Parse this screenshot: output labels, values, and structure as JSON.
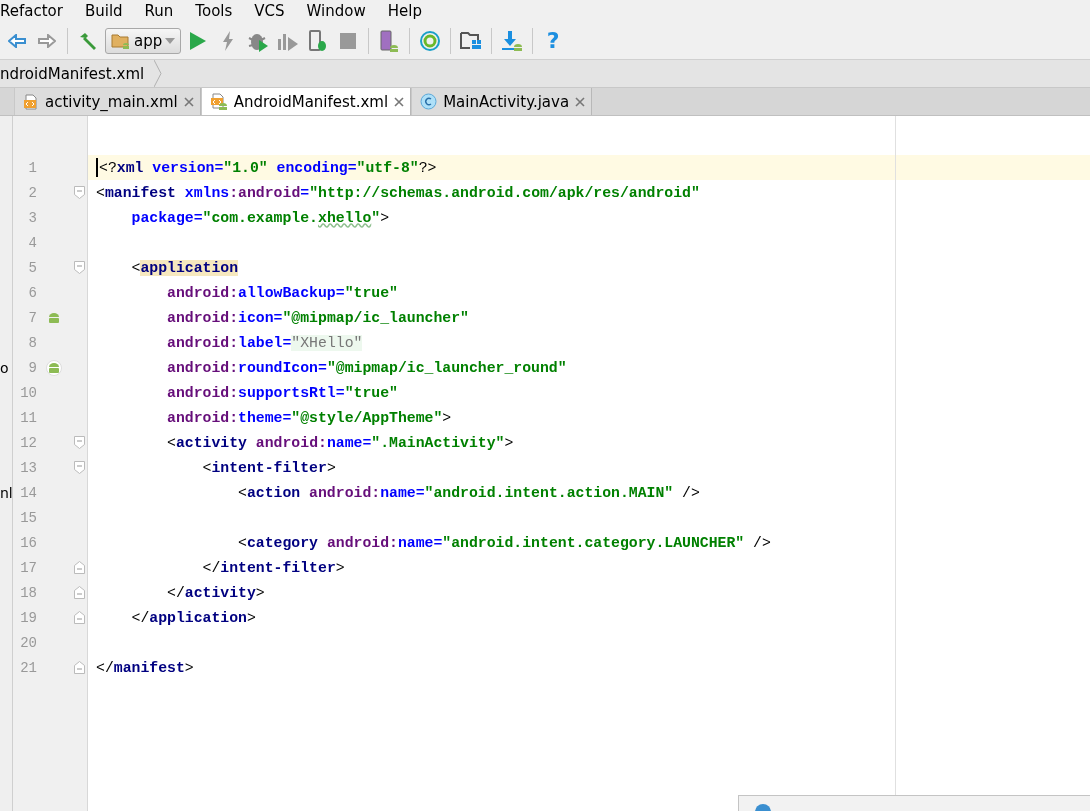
{
  "menu": [
    "Refactor",
    "Build",
    "Run",
    "Tools",
    "VCS",
    "Window",
    "Help"
  ],
  "toolbar": {
    "config": "app",
    "help": "?"
  },
  "breadcrumb": "ndroidManifest.xml",
  "tabs": [
    {
      "label": "activity_main.xml",
      "kind": "xml",
      "selected": false
    },
    {
      "label": "AndroidManifest.xml",
      "kind": "manifest",
      "selected": true
    },
    {
      "label": "MainActivity.java",
      "kind": "class",
      "selected": false
    }
  ],
  "lines": [
    {
      "number": "1",
      "current": true,
      "tokens": [
        {
          "kind": "punct",
          "text": "<?"
        },
        {
          "kind": "tag",
          "text": "xml"
        },
        {
          "kind": "attr",
          "text": " version="
        },
        {
          "kind": "value",
          "text": "\"1.0\""
        },
        {
          "kind": "attr",
          "text": " encoding="
        },
        {
          "kind": "value",
          "text": "\"utf-8\""
        },
        {
          "kind": "punct",
          "text": "?>"
        }
      ]
    },
    {
      "number": "2",
      "current": false,
      "fold_start": true,
      "tokens": [
        {
          "kind": "punct",
          "text": "<"
        },
        {
          "kind": "tag",
          "text": "manifest"
        },
        {
          "kind": "attr",
          "text": " xmlns"
        },
        {
          "kind": "ns",
          "text": ":android"
        },
        {
          "kind": "attr",
          "text": "="
        },
        {
          "kind": "value",
          "text": "\"http://schemas.android.com/apk/res/android\""
        }
      ]
    },
    {
      "number": "3",
      "current": false,
      "tokens": [
        {
          "kind": "attr",
          "text": "    package="
        },
        {
          "kind": "value",
          "text": "\"com.example."
        },
        {
          "kind": "value",
          "text": "xhello",
          "typo": true
        },
        {
          "kind": "value",
          "text": "\""
        },
        {
          "kind": "punct",
          "text": ">"
        }
      ]
    },
    {
      "number": "4",
      "current": false
    },
    {
      "number": "5",
      "current": false,
      "fold_start": true,
      "tokens": [
        {
          "kind": "punct",
          "text": "    <"
        },
        {
          "kind": "tag",
          "text": "application",
          "matched": true
        }
      ]
    },
    {
      "number": "6",
      "current": false,
      "tokens": [
        {
          "kind": "ns",
          "text": "        android:"
        },
        {
          "kind": "attr",
          "text": "allowBackup="
        },
        {
          "kind": "value",
          "text": "\"true\""
        }
      ]
    },
    {
      "number": "7",
      "current": false,
      "android_icon": true,
      "tokens": [
        {
          "kind": "ns",
          "text": "        android:"
        },
        {
          "kind": "attr",
          "text": "icon="
        },
        {
          "kind": "value",
          "text": "\"@mipmap/ic_launcher\""
        }
      ]
    },
    {
      "number": "8",
      "current": false,
      "tokens": [
        {
          "kind": "ns",
          "text": "        android:"
        },
        {
          "kind": "attr",
          "text": "label="
        },
        {
          "kind": "value",
          "text": "\"XHello\"",
          "hint": true
        }
      ]
    },
    {
      "number": "9",
      "current": false,
      "android_round_icon": true,
      "side_text": "o",
      "tokens": [
        {
          "kind": "ns",
          "text": "        android:"
        },
        {
          "kind": "attr",
          "text": "roundIcon="
        },
        {
          "kind": "value",
          "text": "\"@mipmap/ic_launcher_round\""
        }
      ]
    },
    {
      "number": "10",
      "current": false,
      "tokens": [
        {
          "kind": "ns",
          "text": "        android:"
        },
        {
          "kind": "attr",
          "text": "supportsRtl="
        },
        {
          "kind": "value",
          "text": "\"true\""
        }
      ]
    },
    {
      "number": "11",
      "current": false,
      "tokens": [
        {
          "kind": "ns",
          "text": "        android:"
        },
        {
          "kind": "attr",
          "text": "theme="
        },
        {
          "kind": "value",
          "text": "\"@style/AppTheme\""
        },
        {
          "kind": "punct",
          "text": ">"
        }
      ]
    },
    {
      "number": "12",
      "current": false,
      "fold_start": true,
      "tokens": [
        {
          "kind": "punct",
          "text": "        <"
        },
        {
          "kind": "tag",
          "text": "activity"
        },
        {
          "kind": "ns",
          "text": " android:"
        },
        {
          "kind": "attr",
          "text": "name="
        },
        {
          "kind": "value",
          "text": "\".MainActivity\""
        },
        {
          "kind": "punct",
          "text": ">"
        }
      ]
    },
    {
      "number": "13",
      "current": false,
      "fold_start": true,
      "tokens": [
        {
          "kind": "punct",
          "text": "            <"
        },
        {
          "kind": "tag",
          "text": "intent-filter"
        },
        {
          "kind": "punct",
          "text": ">"
        }
      ]
    },
    {
      "number": "14",
      "current": false,
      "side_text": "nl",
      "tokens": [
        {
          "kind": "punct",
          "text": "                <"
        },
        {
          "kind": "tag",
          "text": "action"
        },
        {
          "kind": "ns",
          "text": " android:"
        },
        {
          "kind": "attr",
          "text": "name="
        },
        {
          "kind": "value",
          "text": "\"android.intent.action.MAIN\""
        },
        {
          "kind": "punct",
          "text": " />"
        }
      ]
    },
    {
      "number": "15",
      "current": false
    },
    {
      "number": "16",
      "current": false,
      "tokens": [
        {
          "kind": "punct",
          "text": "                <"
        },
        {
          "kind": "tag",
          "text": "category"
        },
        {
          "kind": "ns",
          "text": " android:"
        },
        {
          "kind": "attr",
          "text": "name="
        },
        {
          "kind": "value",
          "text": "\"android.intent.category.LAUNCHER\""
        },
        {
          "kind": "punct",
          "text": " />"
        }
      ]
    },
    {
      "number": "17",
      "current": false,
      "fold_end": true,
      "tokens": [
        {
          "kind": "punct",
          "text": "            </"
        },
        {
          "kind": "tag",
          "text": "intent-filter"
        },
        {
          "kind": "punct",
          "text": ">"
        }
      ]
    },
    {
      "number": "18",
      "current": false,
      "fold_end": true,
      "tokens": [
        {
          "kind": "punct",
          "text": "        </"
        },
        {
          "kind": "tag",
          "text": "activity"
        },
        {
          "kind": "punct",
          "text": ">"
        }
      ]
    },
    {
      "number": "19",
      "current": false,
      "fold_end": true,
      "tokens": [
        {
          "kind": "punct",
          "text": "    </"
        },
        {
          "kind": "tag",
          "text": "application"
        },
        {
          "kind": "punct",
          "text": ">"
        }
      ]
    },
    {
      "number": "20",
      "current": false
    },
    {
      "number": "21",
      "current": false,
      "fold_end": true,
      "tokens": [
        {
          "kind": "punct",
          "text": "</"
        },
        {
          "kind": "tag",
          "text": "manifest"
        },
        {
          "kind": "punct",
          "text": ">"
        }
      ]
    }
  ]
}
